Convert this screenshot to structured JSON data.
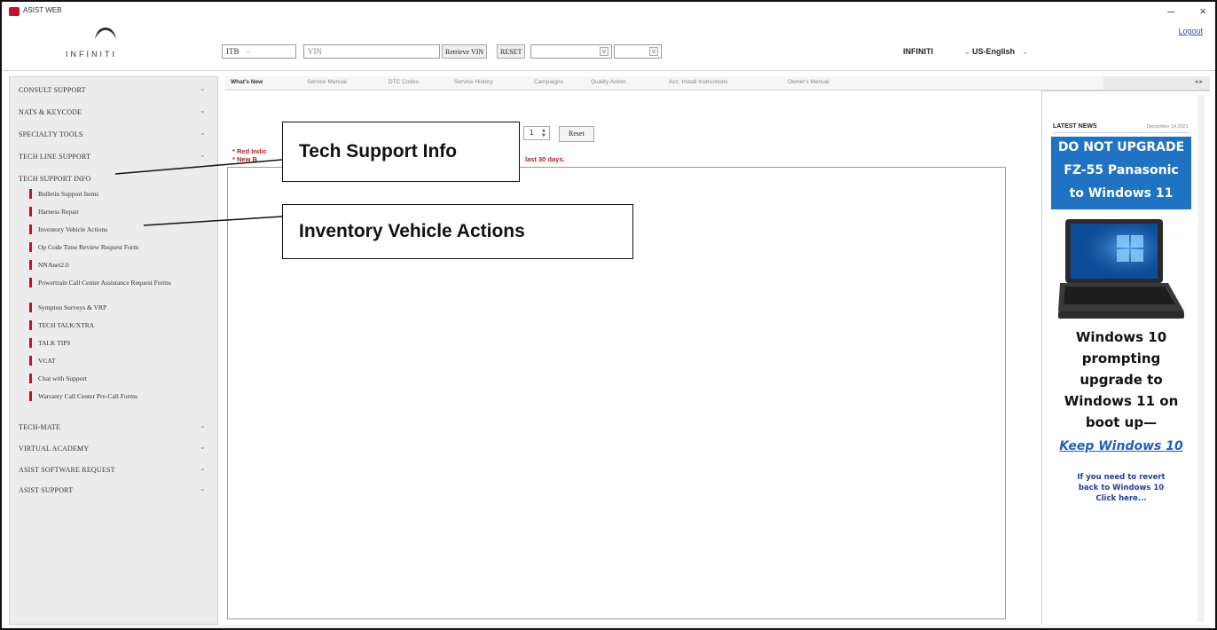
{
  "window": {
    "title": "ASIST WEB",
    "minimize_glyph": "–",
    "close_glyph": "×"
  },
  "header": {
    "brand": "INFINITI",
    "logout": "Logout",
    "model_select": "ITB",
    "vin_placeholder": "VIN",
    "retrieve_vin": "Retrieve VIN",
    "reset": "RESET",
    "make_label": "INFINITI",
    "language": "US-English"
  },
  "sidebar": {
    "sections_top": [
      {
        "label": "CONSULT SUPPORT"
      },
      {
        "label": "NATS & KEYCODE"
      },
      {
        "label": "SPECIALTY TOOLS"
      },
      {
        "label": "TECH LINE SUPPORT"
      },
      {
        "label": "TECH SUPPORT INFO"
      }
    ],
    "items": [
      {
        "label": "Bulletin Support Items"
      },
      {
        "label": "Harness Repair"
      },
      {
        "label": "Inventory Vehicle Actions"
      },
      {
        "label": "Op Code Time Review Request Form"
      },
      {
        "label": "NNAnet2.0"
      },
      {
        "label": "Powertrain Call Center Assistance Request Forms"
      },
      {
        "label": "Sympton Surveys & VRP"
      },
      {
        "label": "TECH TALK/XTRA"
      },
      {
        "label": "TALK TIPS"
      },
      {
        "label": "VCAT"
      },
      {
        "label": "Chat with Support"
      },
      {
        "label": "Warranty Call Center Pre-Call Forms"
      }
    ],
    "sections_bottom": [
      {
        "label": "TECH-MATE"
      },
      {
        "label": "VIRTUAL ACADEMY"
      },
      {
        "label": "ASIST SOFTWARE REQUEST"
      },
      {
        "label": "ASIST SUPPORT"
      }
    ]
  },
  "tabs": [
    {
      "label": "What's New"
    },
    {
      "label": "Service Manual"
    },
    {
      "label": "DTC Codes"
    },
    {
      "label": "Service History"
    },
    {
      "label": "Campaigns"
    },
    {
      "label": "Quality Action"
    },
    {
      "label": "Acc. Install Instructions"
    },
    {
      "label": "Owner's Manual"
    }
  ],
  "content": {
    "page_spinner": "1",
    "reset": "Reset",
    "note1": "* Red Indic",
    "note2": "* New B",
    "note_tail": "last 30 days."
  },
  "news": {
    "heading": "LATEST NEWS",
    "date": "December 14 2021",
    "banner_line1": "DO NOT UPGRADE",
    "banner_line2": "FZ-55 Panasonic",
    "banner_line3": "to Windows 11",
    "body_l1": "Windows 10",
    "body_l2": "prompting",
    "body_l3": "upgrade to",
    "body_l4": "Windows 11 on",
    "body_l5": "boot up—",
    "link": "Keep Windows 10",
    "revert_l1": "If you need to revert",
    "revert_l2": "back to Windows 10",
    "revert_l3": "Click here..."
  },
  "callouts": {
    "tech_support": "Tech Support Info",
    "inventory": "Inventory Vehicle Actions"
  },
  "colors": {
    "accent_red": "#c8102e",
    "banner_blue": "#1f73c2",
    "link_blue": "#1e5fc2"
  }
}
